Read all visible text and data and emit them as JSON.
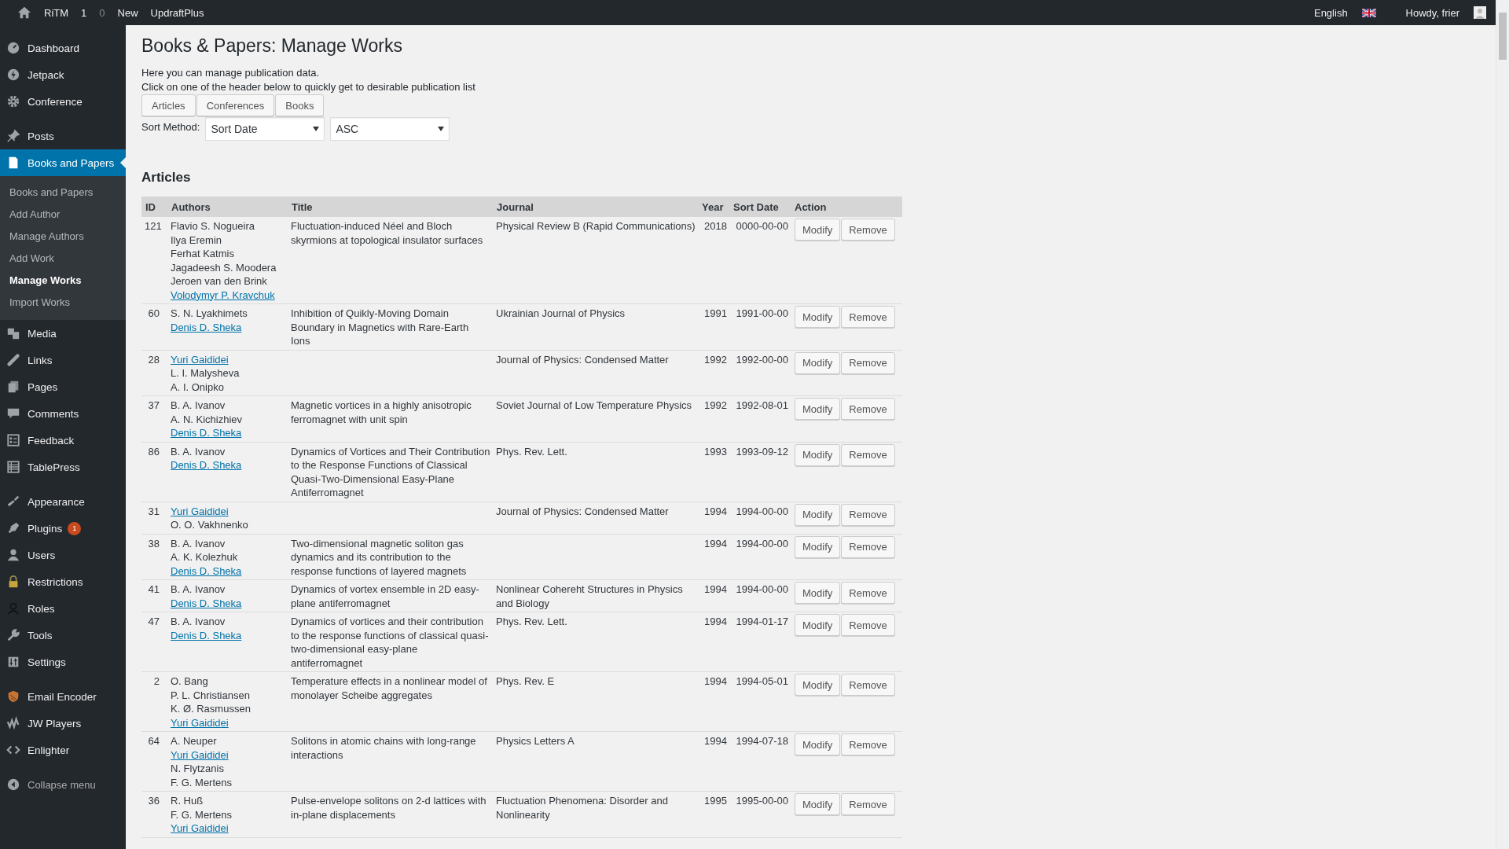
{
  "admin_bar": {
    "site": "RiTM",
    "updates": "1",
    "comments": "0",
    "new": "New",
    "plugin": "UpdraftPlus",
    "language": "English",
    "greeting": "Howdy, frier"
  },
  "sidebar": {
    "groups": [
      [
        {
          "label": "Dashboard",
          "selected": false
        },
        {
          "label": "Jetpack",
          "selected": false
        },
        {
          "label": "Conference",
          "selected": false
        }
      ],
      [
        {
          "label": "Posts",
          "selected": false
        },
        {
          "label": "Books and Papers",
          "selected": true,
          "children": [
            {
              "label": "Books and Papers",
              "selected": false
            },
            {
              "label": "Add Author",
              "selected": false
            },
            {
              "label": "Manage Authors",
              "selected": false
            },
            {
              "label": "Add Work",
              "selected": false
            },
            {
              "label": "Manage Works",
              "selected": true
            },
            {
              "label": "Import Works",
              "selected": false
            }
          ]
        },
        {
          "label": "Media",
          "selected": false
        },
        {
          "label": "Links",
          "selected": false
        },
        {
          "label": "Pages",
          "selected": false
        },
        {
          "label": "Comments",
          "selected": false
        },
        {
          "label": "Feedback",
          "selected": false
        },
        {
          "label": "TablePress",
          "selected": false
        }
      ],
      [
        {
          "label": "Appearance",
          "selected": false
        },
        {
          "label": "Plugins",
          "selected": false,
          "badge": "1"
        },
        {
          "label": "Users",
          "selected": false
        },
        {
          "label": "Restrictions",
          "selected": false
        },
        {
          "label": "Roles",
          "selected": false
        },
        {
          "label": "Tools",
          "selected": false
        },
        {
          "label": "Settings",
          "selected": false
        }
      ],
      [
        {
          "label": "Email Encoder",
          "selected": false
        },
        {
          "label": "JW Players",
          "selected": false
        },
        {
          "label": "Enlighter",
          "selected": false
        }
      ]
    ],
    "collapse": "Collapse menu"
  },
  "page": {
    "title": "Books & Papers: Manage Works",
    "intro": [
      "Here you can manage publication data.",
      "Click on one of the header below to quickly get to desirable publication list"
    ],
    "header_buttons": [
      "Articles",
      "Conferences",
      "Books"
    ],
    "sort": {
      "label": "Sort Method:",
      "field": "Sort Date",
      "order": "ASC"
    },
    "section": "Articles",
    "table": {
      "columns": [
        "ID",
        "Authors",
        "Title",
        "Journal",
        "Year",
        "Sort Date",
        "Action"
      ],
      "rows": [
        {
          "id": "121",
          "authors": [
            {
              "name": "Flavio S. Nogueira",
              "linked": false
            },
            {
              "name": "Ilya Eremin",
              "linked": false
            },
            {
              "name": "Ferhat Katmis",
              "linked": false
            },
            {
              "name": "Jagadeesh S. Moodera",
              "linked": false
            },
            {
              "name": "Jeroen van den Brink",
              "linked": false
            },
            {
              "name": "Volodymyr P. Kravchuk",
              "linked": true
            }
          ],
          "title": "Fluctuation-induced Néel and Bloch skyrmions at topological insulator surfaces",
          "journal": "Physical Review B (Rapid Communications)",
          "year": "2018",
          "sort_date": "0000-00-00",
          "actions": [
            "Modify",
            "Remove"
          ]
        },
        {
          "id": "60",
          "authors": [
            {
              "name": "S. N. Lyakhimets",
              "linked": false
            },
            {
              "name": "Denis D. Sheka",
              "linked": true
            }
          ],
          "title": "Inhibition of Quikly-Moving Domain Boundary in Magnetics with Rare-Earth Ions",
          "journal": "Ukrainian Journal of Physics",
          "year": "1991",
          "sort_date": "1991-00-00",
          "actions": [
            "Modify",
            "Remove"
          ]
        },
        {
          "id": "28",
          "authors": [
            {
              "name": "Yuri Gaididei",
              "linked": true
            },
            {
              "name": "L. I. Malysheva",
              "linked": false
            },
            {
              "name": "A. I. Onipko",
              "linked": false
            }
          ],
          "journal": "Journal of Physics: Condensed Matter",
          "year": "1992",
          "sort_date": "1992-00-00",
          "actions": [
            "Modify",
            "Remove"
          ]
        },
        {
          "id": "37",
          "authors": [
            {
              "name": "B. A. Ivanov",
              "linked": false
            },
            {
              "name": "A. N. Kichizhiev",
              "linked": false
            },
            {
              "name": "Denis D. Sheka",
              "linked": true
            }
          ],
          "title": "Magnetic vortices in a highly anisotropic ferromagnet with unit spin",
          "journal": "Soviet Journal of Low Temperature Physics",
          "year": "1992",
          "sort_date": "1992-08-01",
          "actions": [
            "Modify",
            "Remove"
          ]
        },
        {
          "id": "86",
          "authors": [
            {
              "name": "B. A. Ivanov",
              "linked": false
            },
            {
              "name": "Denis D. Sheka",
              "linked": true
            }
          ],
          "title": "Dynamics of Vortices and Their Contribution to the Response Functions of Classical Quasi-Two-Dimensional Easy-Plane Antiferromagnet",
          "journal": "Phys. Rev. Lett.",
          "year": "1993",
          "sort_date": "1993-09-12",
          "actions": [
            "Modify",
            "Remove"
          ]
        },
        {
          "id": "31",
          "authors": [
            {
              "name": "Yuri Gaididei",
              "linked": true
            },
            {
              "name": "O. O. Vakhnenko",
              "linked": false
            }
          ],
          "journal": "Journal of Physics: Condensed Matter",
          "year": "1994",
          "sort_date": "1994-00-00",
          "actions": [
            "Modify",
            "Remove"
          ]
        },
        {
          "id": "38",
          "authors": [
            {
              "name": "B. A. Ivanov",
              "linked": false
            },
            {
              "name": "A. K. Kolezhuk",
              "linked": false
            },
            {
              "name": "Denis D. Sheka",
              "linked": true
            }
          ],
          "title": "Two-dimensional magnetic soliton gas dynamics and its contribution to the response functions of layered magnets",
          "year": "1994",
          "sort_date": "1994-00-00",
          "actions": [
            "Modify",
            "Remove"
          ]
        },
        {
          "id": "41",
          "authors": [
            {
              "name": "B. A. Ivanov",
              "linked": false
            },
            {
              "name": "Denis D. Sheka",
              "linked": true
            }
          ],
          "title": "Dynamics of vortex ensemble in 2D easy-plane antiferromagnet",
          "journal": "Nonlinear Cohereht Structures in Physics and Biology",
          "year": "1994",
          "sort_date": "1994-00-00",
          "actions": [
            "Modify",
            "Remove"
          ]
        },
        {
          "id": "47",
          "authors": [
            {
              "name": "B. A. Ivanov",
              "linked": false
            },
            {
              "name": "Denis D. Sheka",
              "linked": true
            }
          ],
          "title": "Dynamics of vortices and their contribution to the response functions of classical quasi-two-dimensional easy-plane antiferromagnet",
          "journal": "Phys. Rev. Lett.",
          "year": "1994",
          "sort_date": "1994-01-17",
          "actions": [
            "Modify",
            "Remove"
          ]
        },
        {
          "id": "2",
          "authors": [
            {
              "name": "O. Bang",
              "linked": false
            },
            {
              "name": "P. L. Christiansen",
              "linked": false
            },
            {
              "name": "K. Ø. Rasmussen",
              "linked": false
            },
            {
              "name": "Yuri Gaididei",
              "linked": true
            }
          ],
          "title": "Temperature effects in a nonlinear model of monolayer Scheibe aggregates",
          "journal": "Phys. Rev. E",
          "year": "1994",
          "sort_date": "1994-05-01",
          "actions": [
            "Modify",
            "Remove"
          ]
        },
        {
          "id": "64",
          "authors": [
            {
              "name": "A. Neuper",
              "linked": false
            },
            {
              "name": "Yuri Gaididei",
              "linked": true
            },
            {
              "name": "N. Flytzanis",
              "linked": false
            },
            {
              "name": "F. G. Mertens",
              "linked": false
            }
          ],
          "title": "Solitons in atomic chains with long-range interactions",
          "journal": "Physics Letters A",
          "year": "1994",
          "sort_date": "1994-07-18",
          "actions": [
            "Modify",
            "Remove"
          ]
        },
        {
          "id": "36",
          "authors": [
            {
              "name": "R. Huß",
              "linked": false
            },
            {
              "name": "F. G. Mertens",
              "linked": false
            },
            {
              "name": "Yuri Gaididei",
              "linked": true
            }
          ],
          "title": "Pulse-envelope solitons on 2-d lattices with in-plane displacements",
          "journal": "Fluctuation Phenomena: Disorder and Nonlinearity",
          "year": "1995",
          "sort_date": "1995-00-00",
          "actions": [
            "Modify",
            "Remove"
          ]
        }
      ]
    }
  }
}
